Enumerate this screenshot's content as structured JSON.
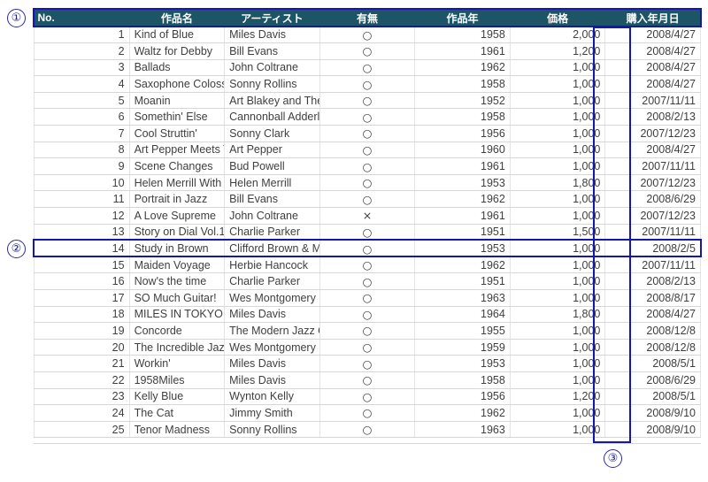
{
  "document": {
    "kind": "spreadsheet-table",
    "accent_color": "#1515b0",
    "header_bg": "#1d5566",
    "header_fg": "#ffffff"
  },
  "markers": [
    {
      "id": "1",
      "label": "①",
      "target": "header-row"
    },
    {
      "id": "2",
      "label": "②",
      "target": "row-14"
    },
    {
      "id": "3",
      "label": "③",
      "target": "price-column"
    }
  ],
  "table": {
    "columns": [
      {
        "key": "no",
        "label": "No."
      },
      {
        "key": "title",
        "label": "作品名"
      },
      {
        "key": "artist",
        "label": "アーティスト"
      },
      {
        "key": "have",
        "label": "有無"
      },
      {
        "key": "year",
        "label": "作品年"
      },
      {
        "key": "price",
        "label": "価格"
      },
      {
        "key": "date",
        "label": "購入年月日"
      }
    ],
    "rows": [
      {
        "no": "1",
        "title": "Kind of Blue",
        "artist": "Miles Davis",
        "have": "○",
        "year": "1958",
        "price": "2,000",
        "date": "2008/4/27"
      },
      {
        "no": "2",
        "title": "Waltz for Debby",
        "artist": "Bill Evans",
        "have": "○",
        "year": "1961",
        "price": "1,200",
        "date": "2008/4/27"
      },
      {
        "no": "3",
        "title": "Ballads",
        "artist": "John Coltrane",
        "have": "○",
        "year": "1962",
        "price": "1,000",
        "date": "2008/4/27"
      },
      {
        "no": "4",
        "title": "Saxophone Colossus",
        "artist": "Sonny Rollins",
        "have": "○",
        "year": "1958",
        "price": "1,000",
        "date": "2008/4/27"
      },
      {
        "no": "5",
        "title": "Moanin",
        "artist": "Art Blakey and The Jazz Messengers",
        "have": "○",
        "year": "1952",
        "price": "1,000",
        "date": "2007/11/11"
      },
      {
        "no": "6",
        "title": "Somethin' Else",
        "artist": "Cannonball Adderley",
        "have": "○",
        "year": "1958",
        "price": "1,000",
        "date": "2008/2/13"
      },
      {
        "no": "7",
        "title": "Cool Struttin'",
        "artist": "Sonny Clark",
        "have": "○",
        "year": "1956",
        "price": "1,000",
        "date": "2007/12/23"
      },
      {
        "no": "8",
        "title": "Art Pepper Meets The Rhythm Section",
        "artist": "Art Pepper",
        "have": "○",
        "year": "1960",
        "price": "1,000",
        "date": "2008/4/27"
      },
      {
        "no": "9",
        "title": "Scene Changes",
        "artist": "Bud Powell",
        "have": "○",
        "year": "1961",
        "price": "1,000",
        "date": "2007/11/11"
      },
      {
        "no": "10",
        "title": "Helen Merrill With Clifford Brown",
        "artist": "Helen Merrill",
        "have": "○",
        "year": "1953",
        "price": "1,800",
        "date": "2007/12/23"
      },
      {
        "no": "11",
        "title": "Portrait in Jazz",
        "artist": "Bill Evans",
        "have": "○",
        "year": "1962",
        "price": "1,000",
        "date": "2008/6/29"
      },
      {
        "no": "12",
        "title": "A Love Supreme",
        "artist": "John Coltrane",
        "have": "×",
        "year": "1961",
        "price": "1,000",
        "date": "2007/12/23"
      },
      {
        "no": "13",
        "title": "Story on Dial Vol.1",
        "artist": "Charlie Parker",
        "have": "○",
        "year": "1951",
        "price": "1,500",
        "date": "2007/11/11"
      },
      {
        "no": "14",
        "title": "Study in Brown",
        "artist": "Clifford Brown & Max Roach",
        "have": "○",
        "year": "1953",
        "price": "1,000",
        "date": "2008/2/5"
      },
      {
        "no": "15",
        "title": "Maiden Voyage",
        "artist": "Herbie Hancock",
        "have": "○",
        "year": "1962",
        "price": "1,000",
        "date": "2007/11/11"
      },
      {
        "no": "16",
        "title": "Now's the time",
        "artist": "Charlie Parker",
        "have": "○",
        "year": "1951",
        "price": "1,000",
        "date": "2008/2/13"
      },
      {
        "no": "17",
        "title": "SO Much Guitar!",
        "artist": "Wes Montgomery",
        "have": "○",
        "year": "1963",
        "price": "1,000",
        "date": "2008/8/17"
      },
      {
        "no": "18",
        "title": "MILES IN TOKYO",
        "artist": "Miles Davis",
        "have": "○",
        "year": "1964",
        "price": "1,800",
        "date": "2008/4/27"
      },
      {
        "no": "19",
        "title": "Concorde",
        "artist": "The Modern Jazz Quartet",
        "have": "○",
        "year": "1955",
        "price": "1,000",
        "date": "2008/12/8"
      },
      {
        "no": "20",
        "title": "The Incredible Jazz Guitar",
        "artist": "Wes Montgomery",
        "have": "○",
        "year": "1959",
        "price": "1,000",
        "date": "2008/12/8"
      },
      {
        "no": "21",
        "title": "Workin'",
        "artist": "Miles Davis",
        "have": "○",
        "year": "1953",
        "price": "1,000",
        "date": "2008/5/1"
      },
      {
        "no": "22",
        "title": "1958Miles",
        "artist": "Miles Davis",
        "have": "○",
        "year": "1958",
        "price": "1,000",
        "date": "2008/6/29"
      },
      {
        "no": "23",
        "title": "Kelly Blue",
        "artist": "Wynton Kelly",
        "have": "○",
        "year": "1956",
        "price": "1,200",
        "date": "2008/5/1"
      },
      {
        "no": "24",
        "title": "The Cat",
        "artist": "Jimmy Smith",
        "have": "○",
        "year": "1962",
        "price": "1,000",
        "date": "2008/9/10"
      },
      {
        "no": "25",
        "title": "Tenor Madness",
        "artist": "Sonny Rollins",
        "have": "○",
        "year": "1963",
        "price": "1,000",
        "date": "2008/9/10"
      }
    ]
  }
}
